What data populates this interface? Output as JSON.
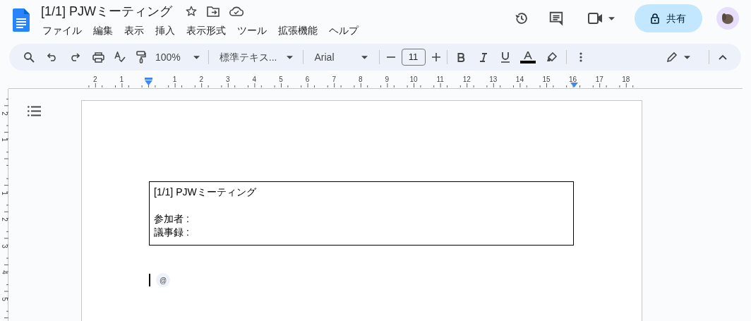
{
  "document": {
    "title": "[1/1] PJWミーティング"
  },
  "menu": [
    {
      "label": "ファイル"
    },
    {
      "label": "編集"
    },
    {
      "label": "表示"
    },
    {
      "label": "挿入"
    },
    {
      "label": "表示形式"
    },
    {
      "label": "ツール"
    },
    {
      "label": "拡張機能"
    },
    {
      "label": "ヘルプ"
    }
  ],
  "share_button": {
    "label": "共有"
  },
  "toolbar": {
    "zoom": "100%",
    "style": "標準テキス...",
    "font": "Arial",
    "font_size": "11"
  },
  "ruler": {
    "horizontal": [
      "2",
      "1",
      "1",
      "2",
      "3",
      "4",
      "5",
      "6",
      "7",
      "8",
      "9",
      "10",
      "11",
      "12",
      "13",
      "14",
      "15",
      "16",
      "17",
      "18"
    ],
    "vertical": [
      "2",
      "1",
      "1",
      "2",
      "3",
      "4",
      "5"
    ]
  },
  "page": {
    "table_cell": {
      "title": "[1/1] PJWミーティング",
      "lines": [
        "参加者 :",
        "議事録 :"
      ]
    },
    "smart_chip": "@"
  }
}
